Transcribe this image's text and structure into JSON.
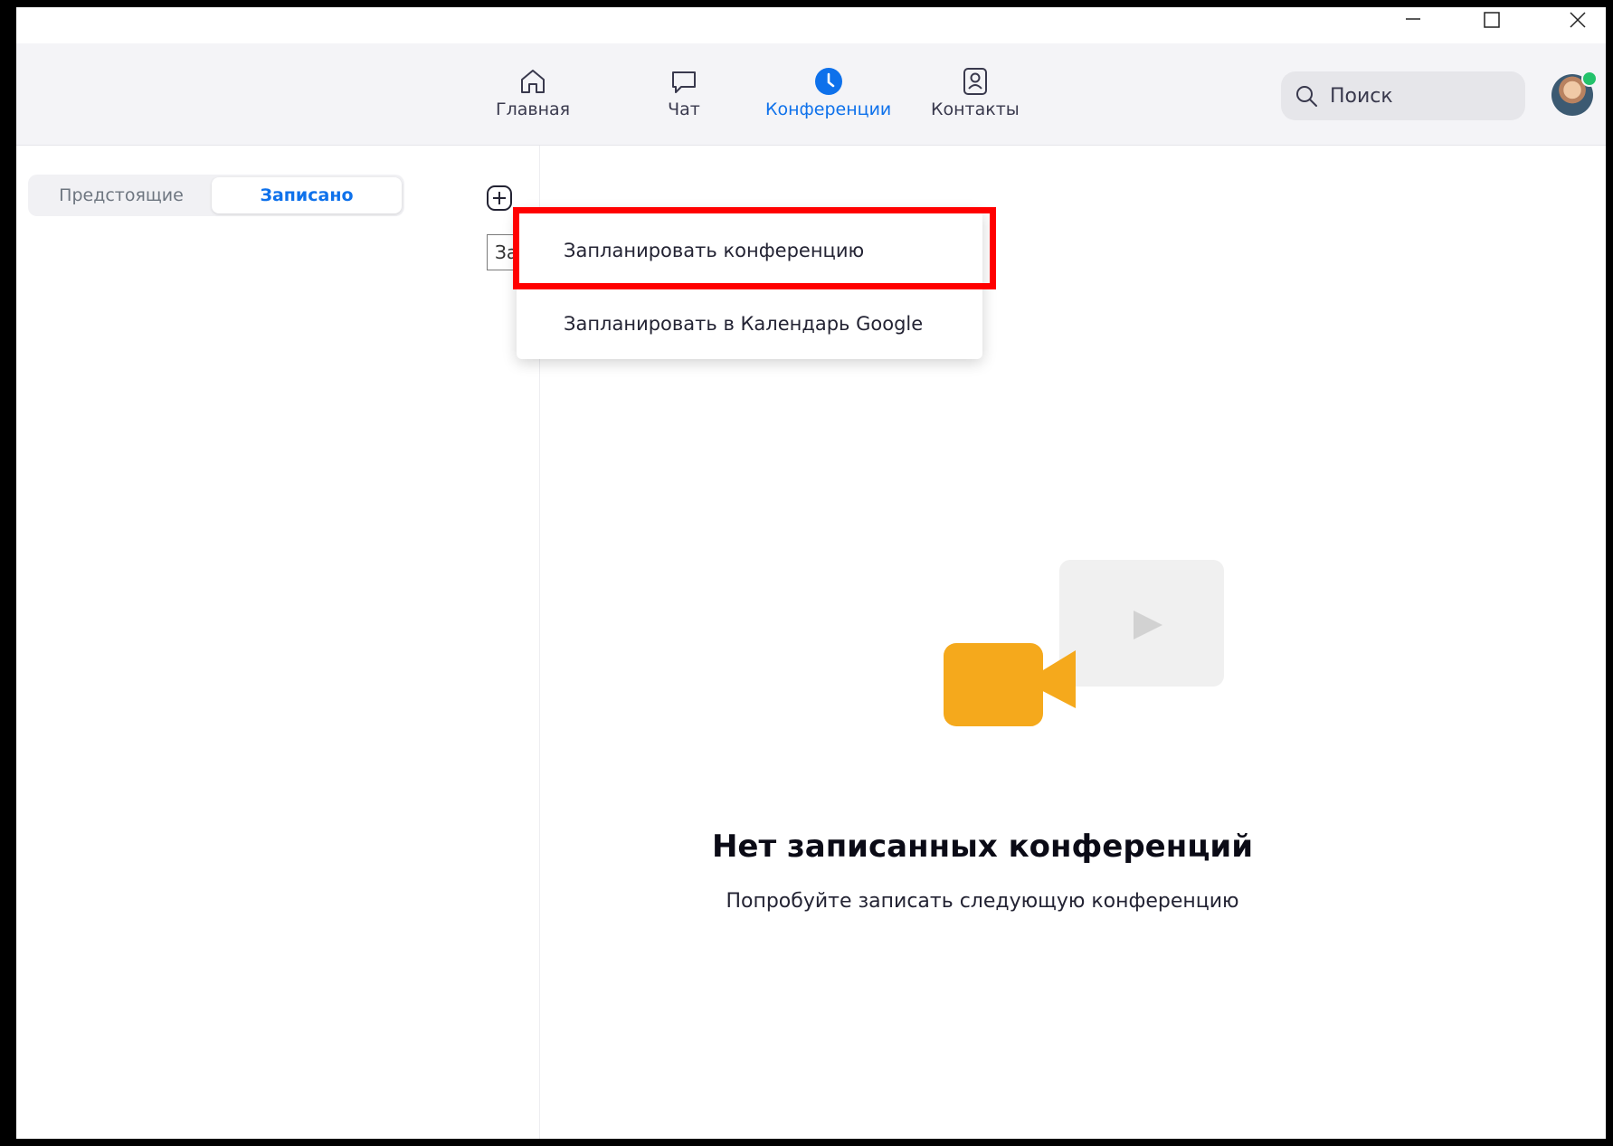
{
  "window": {
    "controls": {
      "minimize_icon": "minimize-icon",
      "maximize_icon": "maximize-icon",
      "close_icon": "close-icon"
    }
  },
  "nav": {
    "items": [
      {
        "label": "Главная",
        "icon": "home-icon",
        "active": false
      },
      {
        "label": "Чат",
        "icon": "chat-bubble-icon",
        "active": false
      },
      {
        "label": "Конференции",
        "icon": "clock-icon",
        "active": true
      },
      {
        "label": "Контакты",
        "icon": "contact-card-icon",
        "active": false
      }
    ]
  },
  "search": {
    "placeholder": "Поиск",
    "icon": "search-icon"
  },
  "profile": {
    "status": "online",
    "status_color": "#23c26b"
  },
  "sidebar": {
    "tabs": [
      {
        "label": "Предстоящие",
        "selected": false
      },
      {
        "label": "Записано",
        "selected": true
      }
    ],
    "add_icon": "plus-circle-icon",
    "tooltip_fragment": "За"
  },
  "dropdown": {
    "items": [
      {
        "label": "Запланировать конференцию",
        "highlighted": true
      },
      {
        "label": "Запланировать в Календарь Google",
        "highlighted": false
      }
    ]
  },
  "empty_state": {
    "title": "Нет записанных конференций",
    "subtitle": "Попробуйте записать следующую конференцию",
    "illustration": "video-camera-illustration"
  },
  "colors": {
    "accent": "#0e71eb",
    "highlight_border": "#ff0000",
    "camera": "#f5a91c"
  }
}
